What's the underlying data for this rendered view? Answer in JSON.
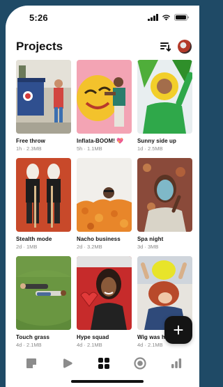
{
  "status": {
    "time": "5:26"
  },
  "header": {
    "title": "Projects"
  },
  "projects": [
    {
      "name": "Free throw",
      "meta": "1h · 2.3MB"
    },
    {
      "name": "Inflata-BOOM! 💖",
      "meta": "5h · 1.1MB"
    },
    {
      "name": "Sunny side up",
      "meta": "1d · 2.5MB"
    },
    {
      "name": "Stealth mode",
      "meta": "2d · 1MB"
    },
    {
      "name": "Nacho business",
      "meta": "2d · 3.2MB"
    },
    {
      "name": "Spa night",
      "meta": "3d · 3MB"
    },
    {
      "name": "Touch grass",
      "meta": "4d · 2.1MB"
    },
    {
      "name": "Hype squad",
      "meta": "4d · 2.1MB"
    },
    {
      "name": "Wig was here",
      "meta": "4d · 2.1MB"
    }
  ],
  "fab": {
    "label": "+"
  },
  "tabs": [
    "drafts-icon",
    "play-icon",
    "grid-icon",
    "record-icon",
    "stats-icon"
  ],
  "colors": {
    "background": "#1f4a66",
    "fab": "#141414",
    "active_tab": "#111111",
    "inactive_tab": "#8c8c8c"
  }
}
